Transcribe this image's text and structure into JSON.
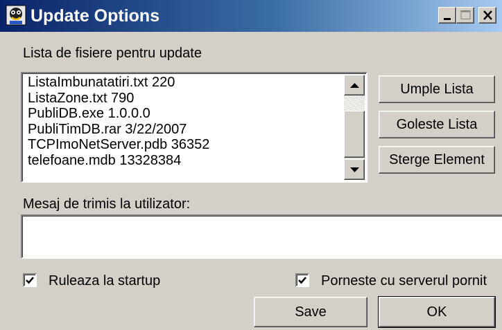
{
  "window": {
    "title": "Update Options",
    "controls": {
      "minimize": "minimize",
      "maximize": "maximize",
      "close": "close"
    }
  },
  "files_section": {
    "label": "Lista de fisiere pentru update",
    "items": [
      "ListaImbunatatiri.txt 220",
      "ListaZone.txt 790",
      "PubliDB.exe 1.0.0.0",
      "PubliTimDB.rar 3/22/2007",
      "TCPImoNetServer.pdb 36352",
      "telefoane.mdb 13328384"
    ]
  },
  "buttons": {
    "fill_list": "Umple Lista",
    "clear_list": "Goleste Lista",
    "delete_item": "Sterge Element",
    "save": "Save",
    "ok": "OK"
  },
  "message_section": {
    "label": "Mesaj de trimis la utilizator:",
    "value": ""
  },
  "options": {
    "run_at_startup": {
      "label": "Ruleaza la startup",
      "checked": true
    },
    "start_with_server": {
      "label": "Porneste cu serverul pornit",
      "checked": true
    }
  },
  "colors": {
    "title_gradient_start": "#0a246a",
    "title_gradient_end": "#a6caf0",
    "face": "#d4d0c8"
  },
  "icons": [
    "app-icon",
    "minimize-icon",
    "maximize-icon",
    "close-icon",
    "scroll-up-arrow-icon",
    "scroll-down-arrow-icon",
    "checkmark-icon"
  ]
}
